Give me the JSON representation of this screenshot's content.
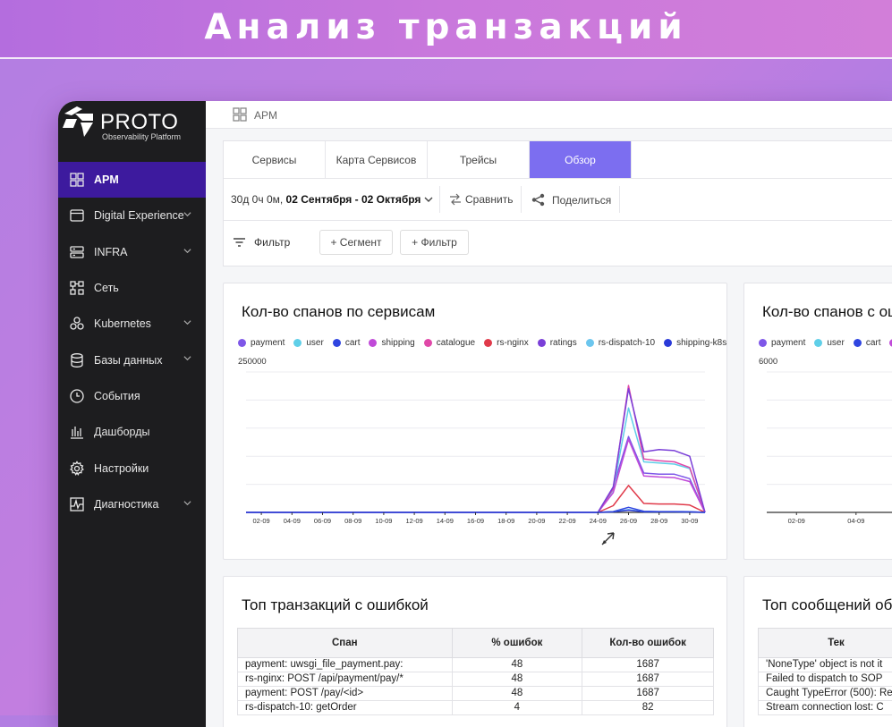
{
  "banner": {
    "title": "Анализ транзакций"
  },
  "logo": {
    "name": "PROTO",
    "subtitle": "Observability Platform"
  },
  "sidebar": {
    "items": [
      {
        "label": "APM",
        "icon": "grid-icon",
        "active": true,
        "expandable": false
      },
      {
        "label": "Digital Experience",
        "icon": "browser-window-icon",
        "active": false,
        "expandable": true
      },
      {
        "label": "INFRA",
        "icon": "server-icon",
        "active": false,
        "expandable": true
      },
      {
        "label": "Сеть",
        "icon": "network-icon",
        "active": false,
        "expandable": false
      },
      {
        "label": "Kubernetes",
        "icon": "kubernetes-icon",
        "active": false,
        "expandable": true
      },
      {
        "label": "Базы данных",
        "icon": "database-icon",
        "active": false,
        "expandable": true
      },
      {
        "label": "События",
        "icon": "clock-icon",
        "active": false,
        "expandable": false
      },
      {
        "label": "Дашборды",
        "icon": "bar-chart-icon",
        "active": false,
        "expandable": false
      },
      {
        "label": "Настройки",
        "icon": "gear-icon",
        "active": false,
        "expandable": false
      },
      {
        "label": "Диагностика",
        "icon": "pulse-icon",
        "active": false,
        "expandable": true
      }
    ]
  },
  "breadcrumb": {
    "label": "APM"
  },
  "tabs": [
    {
      "label": "Сервисы",
      "active": false
    },
    {
      "label": "Карта Сервисов",
      "active": false
    },
    {
      "label": "Трейсы",
      "active": false
    },
    {
      "label": "Обзор",
      "active": true
    }
  ],
  "daterange": {
    "prefix": "30д 0ч 0м,",
    "range": "02 Сентября - 02 Октября"
  },
  "actions": {
    "compare": "Сравнить",
    "share": "Поделиться"
  },
  "filters": {
    "label": "Фильтр",
    "segment_button": "+ Сегмент",
    "filter_button": "+ Фильтр"
  },
  "colors": {
    "accent": "#7c6ef0",
    "sidebar_active": "#3d1a9e",
    "payment": "#7e57e8",
    "user": "#5fcfe8",
    "cart": "#2f45e0",
    "shipping": "#c04ad8",
    "catalogue": "#e048a8",
    "rs-nginx": "#e03a4a",
    "ratings": "#7a3fd8",
    "rs-dispatch-10": "#6cc6ee",
    "shipping-k8s": "#2a3ad8"
  },
  "chart_data": [
    {
      "type": "line",
      "title": "Кол-во спанов по сервисам",
      "ylim": [
        0,
        250000
      ],
      "y_tick_labels": [
        "250000"
      ],
      "grid": true,
      "legend_position": "top-left",
      "x": [
        "01-09",
        "02-09",
        "03-09",
        "04-09",
        "05-09",
        "06-09",
        "07-09",
        "08-09",
        "09-09",
        "10-09",
        "11-09",
        "12-09",
        "13-09",
        "14-09",
        "15-09",
        "16-09",
        "17-09",
        "18-09",
        "19-09",
        "20-09",
        "21-09",
        "22-09",
        "23-09",
        "24-09",
        "25-09",
        "26-09",
        "27-09",
        "28-09",
        "29-09",
        "30-09",
        "01-10"
      ],
      "x_tick_labels": [
        "02-09",
        "04-09",
        "06-09",
        "08-09",
        "10-09",
        "12-09",
        "14-09",
        "16-09",
        "18-09",
        "20-09",
        "22-09",
        "24-09",
        "26-09",
        "28-09",
        "30-09"
      ],
      "series": [
        {
          "name": "payment",
          "color": "#7e57e8",
          "values": [
            0,
            0,
            0,
            0,
            0,
            0,
            0,
            0,
            0,
            0,
            0,
            0,
            0,
            0,
            0,
            0,
            0,
            0,
            0,
            0,
            0,
            0,
            0,
            0,
            45000,
            135000,
            70000,
            68000,
            68000,
            60000,
            0
          ]
        },
        {
          "name": "user",
          "color": "#5fcfe8",
          "values": [
            0,
            0,
            0,
            0,
            0,
            0,
            0,
            0,
            0,
            0,
            0,
            0,
            0,
            0,
            0,
            0,
            0,
            0,
            0,
            0,
            0,
            0,
            0,
            0,
            40000,
            186000,
            90000,
            88000,
            86000,
            78000,
            0
          ]
        },
        {
          "name": "cart",
          "color": "#2f45e0",
          "values": [
            0,
            0,
            0,
            0,
            0,
            0,
            0,
            0,
            0,
            0,
            0,
            0,
            0,
            0,
            0,
            0,
            0,
            0,
            0,
            0,
            0,
            0,
            0,
            0,
            1500,
            9000,
            2000,
            1500,
            1500,
            1200,
            0
          ]
        },
        {
          "name": "shipping",
          "color": "#c04ad8",
          "values": [
            0,
            0,
            0,
            0,
            0,
            0,
            0,
            0,
            0,
            0,
            0,
            0,
            0,
            0,
            0,
            0,
            0,
            0,
            0,
            0,
            0,
            0,
            0,
            0,
            35000,
            130000,
            65000,
            63000,
            62000,
            55000,
            0
          ]
        },
        {
          "name": "catalogue",
          "color": "#e048a8",
          "values": [
            0,
            0,
            0,
            0,
            0,
            0,
            0,
            0,
            0,
            0,
            0,
            0,
            0,
            0,
            0,
            0,
            0,
            0,
            0,
            0,
            0,
            0,
            0,
            0,
            42000,
            226000,
            95000,
            92000,
            90000,
            80000,
            0
          ]
        },
        {
          "name": "rs-nginx",
          "color": "#e03a4a",
          "values": [
            0,
            0,
            0,
            0,
            0,
            0,
            0,
            0,
            0,
            0,
            0,
            0,
            0,
            0,
            0,
            0,
            0,
            0,
            0,
            0,
            0,
            0,
            0,
            0,
            12000,
            48000,
            16000,
            15000,
            15000,
            13000,
            0
          ]
        },
        {
          "name": "ratings",
          "color": "#7a3fd8",
          "values": [
            0,
            0,
            0,
            0,
            0,
            0,
            0,
            0,
            0,
            0,
            0,
            0,
            0,
            0,
            0,
            0,
            0,
            0,
            0,
            0,
            0,
            0,
            0,
            0,
            45000,
            220000,
            108000,
            112000,
            110000,
            100000,
            0
          ]
        },
        {
          "name": "rs-dispatch-10",
          "color": "#6cc6ee",
          "values": [
            0,
            0,
            0,
            0,
            0,
            0,
            0,
            0,
            0,
            0,
            0,
            0,
            0,
            0,
            0,
            0,
            0,
            0,
            0,
            0,
            0,
            0,
            0,
            0,
            1000,
            5000,
            1000,
            1000,
            1000,
            800,
            0
          ]
        },
        {
          "name": "shipping-k8s",
          "color": "#2a3ad8",
          "values": [
            0,
            0,
            0,
            0,
            0,
            0,
            0,
            0,
            0,
            0,
            0,
            0,
            0,
            0,
            0,
            0,
            0,
            0,
            0,
            0,
            0,
            0,
            0,
            0,
            1000,
            4000,
            1000,
            1000,
            1000,
            800,
            0
          ]
        }
      ]
    },
    {
      "type": "line",
      "title": "Кол-во спанов с ош",
      "ylim": [
        0,
        6000
      ],
      "y_tick_labels": [
        "6000"
      ],
      "grid": true,
      "legend_position": "top-left",
      "legend_visible": [
        "payment",
        "user",
        "cart",
        ""
      ],
      "x_tick_labels": [
        "02-09",
        "04-09",
        "06-09",
        "08-09"
      ],
      "series": []
    }
  ],
  "tables": [
    {
      "title": "Топ транзакций с ошибкой",
      "columns": [
        "Спан",
        "% ошибок",
        "Кол-во ошибок"
      ],
      "rows": [
        [
          "payment: uwsgi_file_payment.pay:",
          "48",
          "1687"
        ],
        [
          "rs-nginx: POST /api/payment/pay/*",
          "48",
          "1687"
        ],
        [
          "payment: POST /pay/<id>",
          "48",
          "1687"
        ],
        [
          "rs-dispatch-10: getOrder",
          "4",
          "82"
        ]
      ]
    },
    {
      "title": "Топ сообщений об",
      "columns": [
        "Тек"
      ],
      "rows": [
        [
          "'NoneType' object is not it"
        ],
        [
          "Failed to dispatch to SOP"
        ],
        [
          "Caught TypeError (500): Re"
        ],
        [
          "Stream connection lost: C"
        ]
      ]
    }
  ]
}
